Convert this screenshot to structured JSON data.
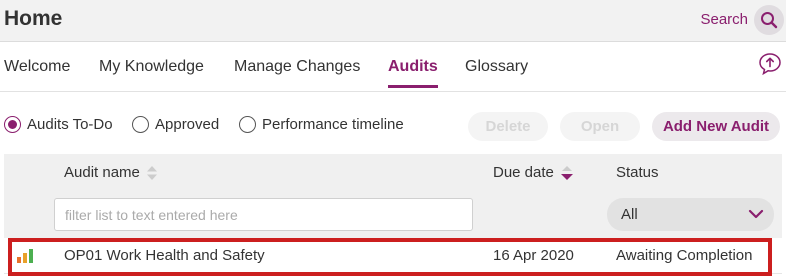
{
  "header": {
    "title": "Home",
    "search_label": "Search",
    "search_icon": "search-icon",
    "accent_color": "#8a1f6e"
  },
  "tabs": [
    {
      "label": "Welcome",
      "active": false
    },
    {
      "label": "My Knowledge",
      "active": false
    },
    {
      "label": "Manage Changes",
      "active": false
    },
    {
      "label": "Audits",
      "active": true
    },
    {
      "label": "Glossary",
      "active": false
    }
  ],
  "upload_icon": "upload-bubble-icon",
  "filters": {
    "options": [
      {
        "label": "Audits To-Do",
        "selected": true
      },
      {
        "label": "Approved",
        "selected": false
      },
      {
        "label": "Performance timeline",
        "selected": false
      }
    ],
    "buttons": {
      "delete": "Delete",
      "open": "Open",
      "add": "Add New Audit"
    }
  },
  "grid": {
    "columns": {
      "name": "Audit name",
      "due": "Due date",
      "status": "Status"
    },
    "filter_placeholder": "filter list to text entered here",
    "status_filter_value": "All",
    "rows": [
      {
        "icon": "bar-chart-icon",
        "name": "OP01 Work Health and Safety",
        "due": "16 Apr 2020",
        "status": "Awaiting Completion"
      }
    ]
  },
  "highlight_color": "#cc1f1f"
}
